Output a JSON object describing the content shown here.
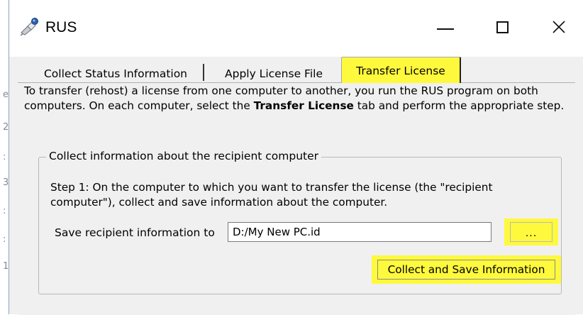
{
  "window": {
    "title": "RUS",
    "controls": {
      "minimize": "minimize-icon",
      "maximize": "maximize-icon",
      "close": "close-icon",
      "close_glyph": "✕"
    },
    "app_icon": "satellite-key-icon"
  },
  "tabs": [
    {
      "label": "Collect Status Information",
      "active": false
    },
    {
      "label": "Apply License File",
      "active": false
    },
    {
      "label": "Transfer License",
      "active": true
    }
  ],
  "transfer": {
    "intro_before": "To transfer (rehost) a license from one computer to another, you run the RUS program on both computers. On each computer, select the ",
    "intro_bold": "Transfer License",
    "intro_after": " tab and perform the appropriate step.",
    "group": {
      "legend": "Collect information about the recipient computer",
      "step_text": "Step 1: On the computer to which you want to transfer the license (the \"recipient computer\"), collect and save information about the computer.",
      "save_label": "Save recipient information to",
      "save_path": "D:/My New PC.id",
      "browse_label": "...",
      "collect_button": "Collect and Save Information"
    }
  },
  "colors": {
    "highlight": "#fff93d",
    "window_bg": "#f0f0f0",
    "titlebar_bg": "#ffffff"
  }
}
